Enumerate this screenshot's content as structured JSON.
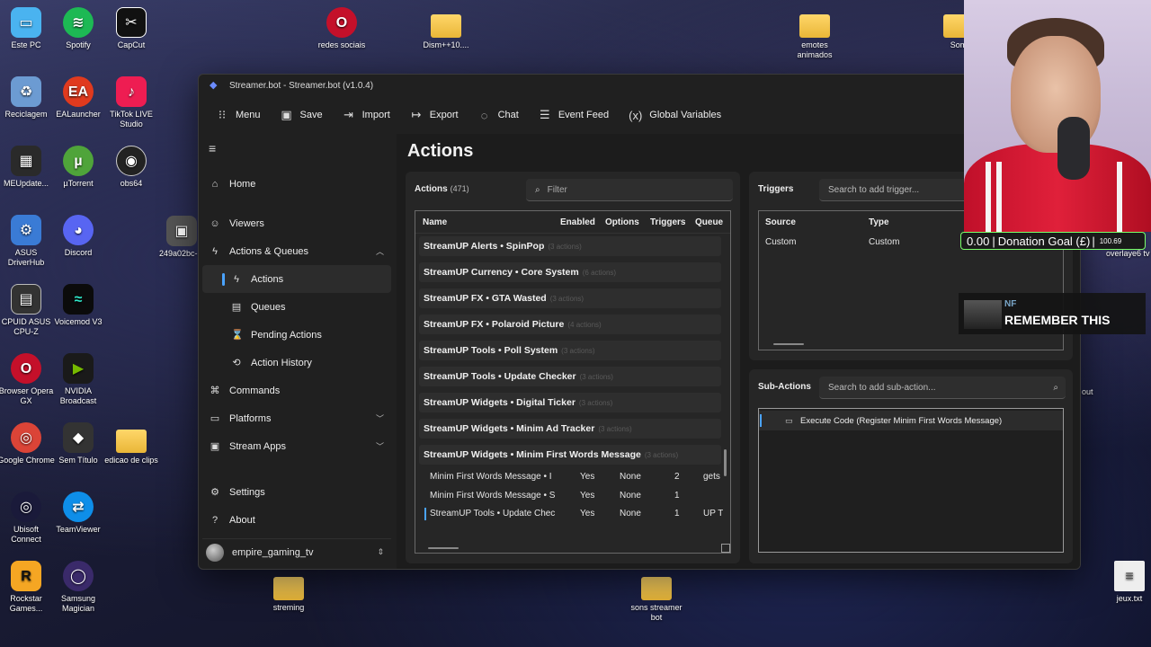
{
  "desktop": {
    "icons": [
      {
        "label": "Este PC",
        "glyph": "▭",
        "color": "#4ab3f0"
      },
      {
        "label": "Spotify",
        "glyph": "≋",
        "color": "#1db954"
      },
      {
        "label": "CapCut",
        "glyph": "✂",
        "color": "#111111"
      },
      {
        "label": "redes sociais",
        "glyph": "O",
        "color": "#c4102a"
      },
      {
        "label": "Dism++10....",
        "glyph": "⚙",
        "color": "#e8b84a"
      },
      {
        "label": "emotes animados",
        "glyph": "",
        "color": "#e8b84a"
      },
      {
        "label": "Reciclagem",
        "glyph": "♻",
        "color": "#6c9bd2"
      },
      {
        "label": "EALauncher",
        "glyph": "EA",
        "color": "#e03a1e"
      },
      {
        "label": "TikTok LIVE Studio",
        "glyph": "♪",
        "color": "#ee1d52"
      },
      {
        "label": "MEUpdate...",
        "glyph": "▦",
        "color": "#2a2a2a"
      },
      {
        "label": "µTorrent",
        "glyph": "µ",
        "color": "#4fa43a"
      },
      {
        "label": "obs64",
        "glyph": "◉",
        "color": "#222222"
      },
      {
        "label": "ASUS DriverHub",
        "glyph": "⚙",
        "color": "#3a7bd5"
      },
      {
        "label": "Discord",
        "glyph": "◕",
        "color": "#5865f2"
      },
      {
        "label": "249a02bc-...",
        "glyph": "▣",
        "color": "#555555"
      },
      {
        "label": "CPUID ASUS CPU-Z",
        "glyph": "▤",
        "color": "#333333"
      },
      {
        "label": "Voicemod V3",
        "glyph": "≈",
        "color": "#0b0b0b"
      },
      {
        "label": "Browser Opera GX",
        "glyph": "O",
        "color": "#c4102a"
      },
      {
        "label": "NVIDIA Broadcast",
        "glyph": "▶",
        "color": "#76b900"
      },
      {
        "label": "Google Chrome",
        "glyph": "◎",
        "color": "#db4437"
      },
      {
        "label": "Sem Título",
        "glyph": "◆",
        "color": "#333333"
      },
      {
        "label": "edicao de clips",
        "glyph": "",
        "color": "#e8b84a"
      },
      {
        "label": "Ubisoft Connect",
        "glyph": "◎",
        "color": "#1a1a3a"
      },
      {
        "label": "TeamViewer",
        "glyph": "⇄",
        "color": "#0e8ee9"
      },
      {
        "label": "Rockstar Games...",
        "glyph": "R",
        "color": "#f5a623"
      },
      {
        "label": "Samsung Magician",
        "glyph": "◯",
        "color": "#3a2a6a"
      },
      {
        "label": "streming",
        "glyph": "",
        "color": "#e8b84a"
      },
      {
        "label": "sons streamer bot",
        "glyph": "",
        "color": "#e8b84a"
      },
      {
        "label": "jeux.txt",
        "glyph": "≡",
        "color": "#dddddd"
      },
      {
        "label": "Som",
        "glyph": "",
        "color": "#e8b84a"
      },
      {
        "label": "overlaye6 tv",
        "glyph": "",
        "color": "#e8b84a"
      },
      {
        "label": "out",
        "glyph": "",
        "color": "#e8b84a"
      }
    ]
  },
  "window": {
    "title": "Streamer.bot - Streamer.bot (v1.0.4)",
    "toolbar": [
      {
        "label": "Menu",
        "icon": "grid-icon",
        "glyph": "⁝⁝"
      },
      {
        "label": "Save",
        "icon": "save-icon",
        "glyph": "▣"
      },
      {
        "label": "Import",
        "icon": "import-icon",
        "glyph": "⇥"
      },
      {
        "label": "Export",
        "icon": "export-icon",
        "glyph": "↦"
      },
      {
        "label": "Chat",
        "icon": "chat-icon",
        "glyph": "◌"
      },
      {
        "label": "Event Feed",
        "icon": "list-icon",
        "glyph": "☰"
      },
      {
        "label": "Global Variables",
        "icon": "variables-icon",
        "glyph": "(x)"
      }
    ],
    "sidebar": {
      "items": [
        {
          "label": "Home",
          "icon": "home-icon",
          "glyph": "⌂"
        },
        {
          "label": "Viewers",
          "icon": "person-icon",
          "glyph": "☺"
        },
        {
          "label": "Actions & Queues",
          "icon": "lightning-icon",
          "glyph": "ϟ"
        },
        {
          "label": "Actions",
          "icon": "lightning-icon",
          "glyph": "ϟ"
        },
        {
          "label": "Queues",
          "icon": "queue-icon",
          "glyph": "▤"
        },
        {
          "label": "Pending Actions",
          "icon": "pending-icon",
          "glyph": "⌛"
        },
        {
          "label": "Action History",
          "icon": "history-icon",
          "glyph": "⟲"
        },
        {
          "label": "Commands",
          "icon": "command-icon",
          "glyph": "⌘"
        },
        {
          "label": "Platforms",
          "icon": "platforms-icon",
          "glyph": "▭"
        },
        {
          "label": "Stream Apps",
          "icon": "apps-icon",
          "glyph": "▣"
        },
        {
          "label": "Settings",
          "icon": "gear-icon",
          "glyph": "⚙"
        },
        {
          "label": "About",
          "icon": "help-icon",
          "glyph": "?"
        }
      ],
      "user": "empire_gaming_tv"
    },
    "page_title": "Actions",
    "actions": {
      "header": "Actions",
      "count": "(471)",
      "filter_placeholder": "Filter",
      "columns": [
        "Name",
        "Enabled",
        "Options",
        "Triggers",
        "Queue"
      ],
      "groups": [
        {
          "name": "StreamUP Alerts • SpinPop",
          "count": "(3 actions)"
        },
        {
          "name": "StreamUP Currency • Core System",
          "count": "(6 actions)"
        },
        {
          "name": "StreamUP FX • GTA Wasted",
          "count": "(3 actions)"
        },
        {
          "name": "StreamUP FX • Polaroid Picture",
          "count": "(4 actions)"
        },
        {
          "name": "StreamUP Tools • Poll System",
          "count": "(3 actions)"
        },
        {
          "name": "StreamUP Tools • Update Checker",
          "count": "(3 actions)"
        },
        {
          "name": "StreamUP Widgets • Digital Ticker",
          "count": "(3 actions)"
        },
        {
          "name": "StreamUP Widgets • Minim Ad Tracker",
          "count": "(3 actions)"
        },
        {
          "name": "StreamUP Widgets • Minim First Words Message",
          "count": "(3 actions)"
        }
      ],
      "rows": [
        {
          "name": "Minim First Words Message • I",
          "enabled": "Yes",
          "options": "None",
          "triggers": "2",
          "queue": "gets"
        },
        {
          "name": "Minim First Words Message • S",
          "enabled": "Yes",
          "options": "None",
          "triggers": "1",
          "queue": ""
        },
        {
          "name": "StreamUP Tools • Update Chec",
          "enabled": "Yes",
          "options": "None",
          "triggers": "1",
          "queue": "UP T"
        }
      ]
    },
    "triggers": {
      "header": "Triggers",
      "search_placeholder": "Search to add trigger...",
      "columns": [
        "Source",
        "Type"
      ],
      "row": {
        "source": "Custom",
        "type": "Custom"
      }
    },
    "subactions": {
      "header": "Sub-Actions",
      "search_placeholder": "Search to add sub-action...",
      "item": "Execute Code (Register Minim First Words Message)"
    }
  },
  "overlay": {
    "donation": {
      "current": "0.00",
      "label": "Donation Goal (£)",
      "goal": "100.69"
    },
    "now_playing": {
      "artist": "NF",
      "title": "REMEMBER THIS"
    }
  },
  "colors": {
    "accent": "#4aa3ff",
    "window_bg": "#202020",
    "panel_bg": "#262626",
    "donation_border": "#7aff6a"
  }
}
